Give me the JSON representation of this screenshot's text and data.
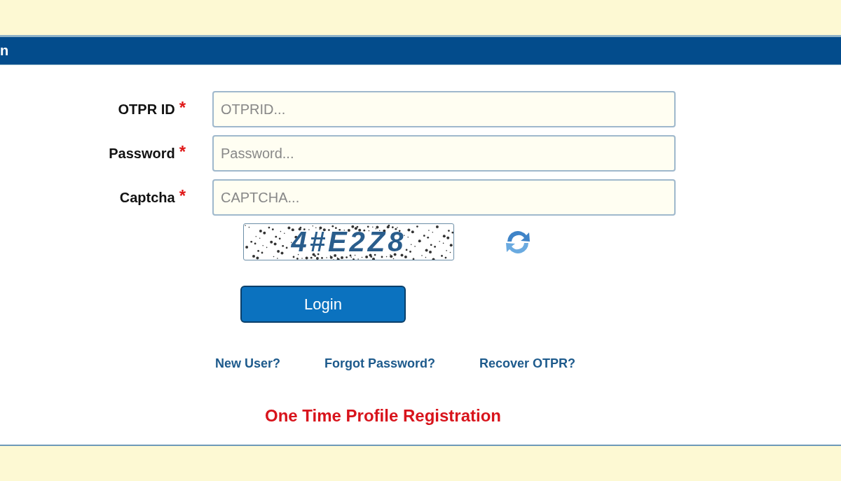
{
  "header": {
    "title": "n"
  },
  "fields": [
    {
      "label": "OTPR ID",
      "required_mark": "*",
      "placeholder": "OTPRID..."
    },
    {
      "label": "Password",
      "required_mark": "*",
      "placeholder": "Password..."
    },
    {
      "label": "Captcha",
      "required_mark": "*",
      "placeholder": "CAPTCHA..."
    }
  ],
  "captcha": {
    "text": "4#E2Z8"
  },
  "login_button": "Login",
  "links": [
    "New User?",
    "Forgot Password?",
    "Recover OTPR?"
  ],
  "registration_link": "One Time Profile Registration"
}
